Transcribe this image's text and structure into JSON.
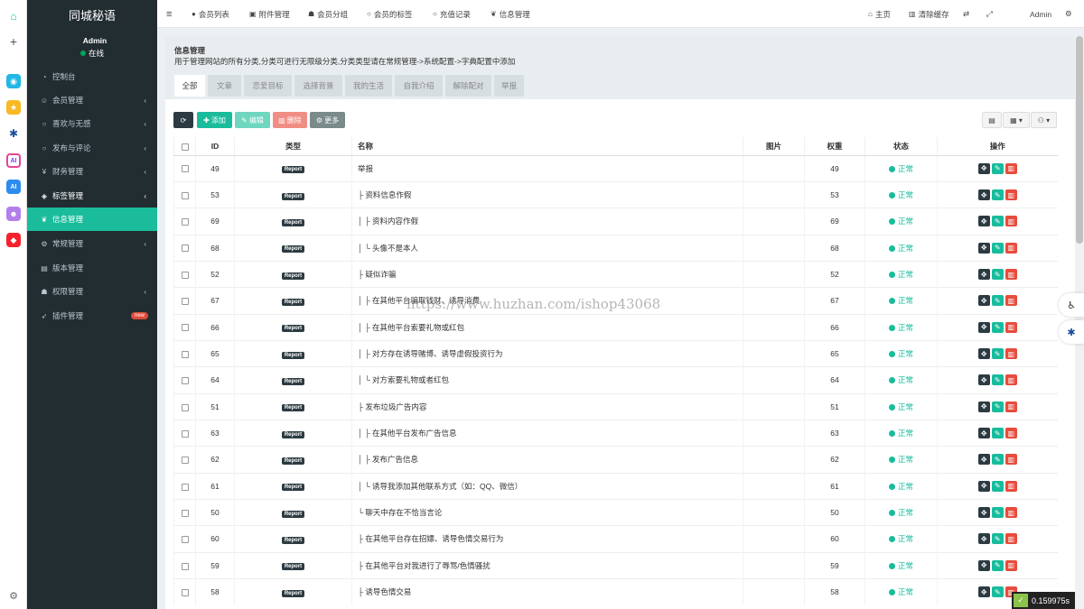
{
  "sidebar": {
    "brand": "同城秘语",
    "user_name": "Admin",
    "user_status": "在线",
    "items": [
      {
        "label": "控制台",
        "icon": "dashboard-icon",
        "arrow": ""
      },
      {
        "label": "会员管理",
        "icon": "user-circle-icon",
        "arrow": "‹"
      },
      {
        "label": "喜欢与无感",
        "icon": "circle-icon",
        "arrow": "‹"
      },
      {
        "label": "发布与评论",
        "icon": "circle-icon",
        "arrow": "‹"
      },
      {
        "label": "财务管理",
        "icon": "yen-icon",
        "arrow": "‹"
      },
      {
        "label": "标签管理",
        "icon": "tags-icon",
        "arrow": "‹"
      },
      {
        "label": "信息管理",
        "icon": "leaf-icon",
        "arrow": ""
      },
      {
        "label": "常规管理",
        "icon": "cogs-icon",
        "arrow": "‹"
      },
      {
        "label": "版本管理",
        "icon": "file-icon",
        "arrow": ""
      },
      {
        "label": "权限管理",
        "icon": "group-icon",
        "arrow": "‹"
      },
      {
        "label": "插件管理",
        "icon": "rocket-icon",
        "arrow": ""
      }
    ],
    "new_badge": "new"
  },
  "topbar": {
    "tabs": [
      {
        "label": "会员列表",
        "icon": "user-icon"
      },
      {
        "label": "附件管理",
        "icon": "file-image-icon"
      },
      {
        "label": "会员分组",
        "icon": "users-icon"
      },
      {
        "label": "会员的标签",
        "icon": "circle-icon"
      },
      {
        "label": "充值记录",
        "icon": "circle-icon"
      },
      {
        "label": "信息管理",
        "icon": "leaf-icon"
      }
    ],
    "home": "主页",
    "clear_cache": "清除缓存",
    "admin": "Admin"
  },
  "panel": {
    "title": "信息管理",
    "description": "用于管理网站的所有分类,分类可进行无限级分类,分类类型请在常规管理->系统配置->字典配置中添加",
    "tabs": [
      "全部",
      "文章",
      "恋爱目标",
      "选择背景",
      "我的生活",
      "自我介绍",
      "解除配对",
      "举报"
    ]
  },
  "toolbar": {
    "add": "添加",
    "edit": "编辑",
    "delete": "删除",
    "more": "更多"
  },
  "table": {
    "headers": [
      "ID",
      "类型",
      "名称",
      "图片",
      "权重",
      "状态",
      "操作"
    ],
    "type_tag": "Report",
    "status_label": "正常",
    "rows": [
      {
        "id": "49",
        "name": "举报",
        "weight": "49"
      },
      {
        "id": "53",
        "name": "├ 资料信息作假",
        "weight": "53"
      },
      {
        "id": "69",
        "name": "│ ├ 资料内容作假",
        "weight": "69"
      },
      {
        "id": "68",
        "name": "│ └ 头像不是本人",
        "weight": "68"
      },
      {
        "id": "52",
        "name": "├ 疑似诈骗",
        "weight": "52"
      },
      {
        "id": "67",
        "name": "│ ├ 在其他平台骗取钱财、诱导消费",
        "weight": "67"
      },
      {
        "id": "66",
        "name": "│ ├ 在其他平台索要礼物或红包",
        "weight": "66"
      },
      {
        "id": "65",
        "name": "│ ├ 对方存在诱导赌博、诱导虚假投资行为",
        "weight": "65"
      },
      {
        "id": "64",
        "name": "│ └ 对方索要礼物或者红包",
        "weight": "64"
      },
      {
        "id": "51",
        "name": "├ 发布垃圾广告内容",
        "weight": "51"
      },
      {
        "id": "63",
        "name": "│ ├ 在其他平台发布广告信息",
        "weight": "63"
      },
      {
        "id": "62",
        "name": "│ ├ 发布广告信息",
        "weight": "62"
      },
      {
        "id": "61",
        "name": "│ └ 诱导我添加其他联系方式（如：QQ、微信）",
        "weight": "61"
      },
      {
        "id": "50",
        "name": "└ 聊天中存在不恰当言论",
        "weight": "50"
      },
      {
        "id": "60",
        "name": "  ├ 在其他平台存在招嫖、诱导色情交易行为",
        "weight": "60"
      },
      {
        "id": "59",
        "name": "  ├ 在其他平台对我进行了辱骂/色情骚扰",
        "weight": "59"
      },
      {
        "id": "58",
        "name": "  ├ 诱导色情交易",
        "weight": "58"
      }
    ]
  },
  "watermark": "https://www.huzhan.com/ishop43068",
  "timer": "0.159975s",
  "colors": {
    "sidebar": "#222d32",
    "accent": "#1abc9c",
    "danger": "#e74c3c",
    "dark": "#2c3b41"
  }
}
